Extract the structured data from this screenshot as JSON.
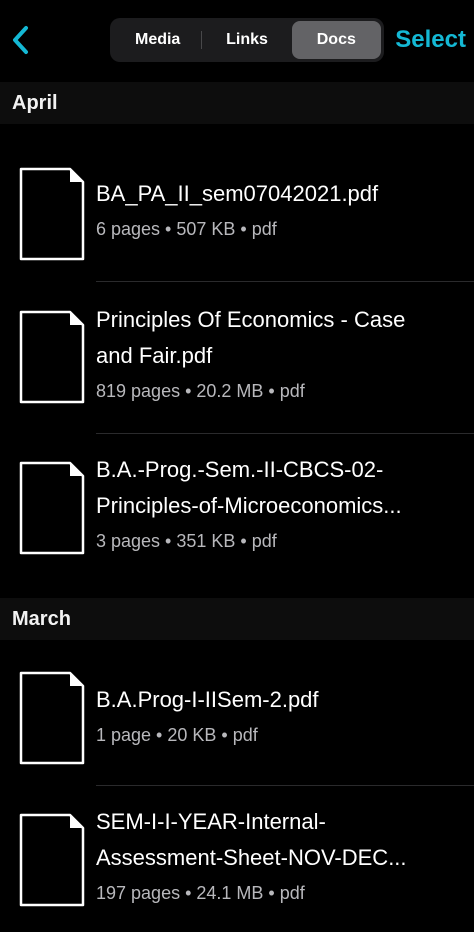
{
  "topbar": {
    "back_icon": "chevron-left-icon",
    "tabs": [
      {
        "label": "Media",
        "active": false
      },
      {
        "label": "Links",
        "active": false
      },
      {
        "label": "Docs",
        "active": true
      }
    ],
    "select_label": "Select",
    "accent_color": "#14b8d4"
  },
  "sections": [
    {
      "title": "April",
      "files": [
        {
          "name_lines": [
            "BA_PA_II_sem07042021.pdf"
          ],
          "meta": "6 pages • 507 KB • pdf"
        },
        {
          "name_lines": [
            "Principles Of Economics - Case",
            "and Fair.pdf"
          ],
          "meta": "819 pages • 20.2 MB • pdf"
        },
        {
          "name_lines": [
            "B.A.-Prog.-Sem.-II-CBCS-02-",
            "Principles-of-Microeconomics..."
          ],
          "meta": "3 pages • 351 KB • pdf"
        }
      ]
    },
    {
      "title": "March",
      "files": [
        {
          "name_lines": [
            "B.A.Prog-I-IISem-2.pdf"
          ],
          "meta": "1 page • 20 KB • pdf"
        },
        {
          "name_lines": [
            "SEM-I-I-YEAR-Internal-",
            "Assessment-Sheet-NOV-DEC..."
          ],
          "meta": "197 pages • 24.1 MB • pdf"
        }
      ]
    }
  ]
}
